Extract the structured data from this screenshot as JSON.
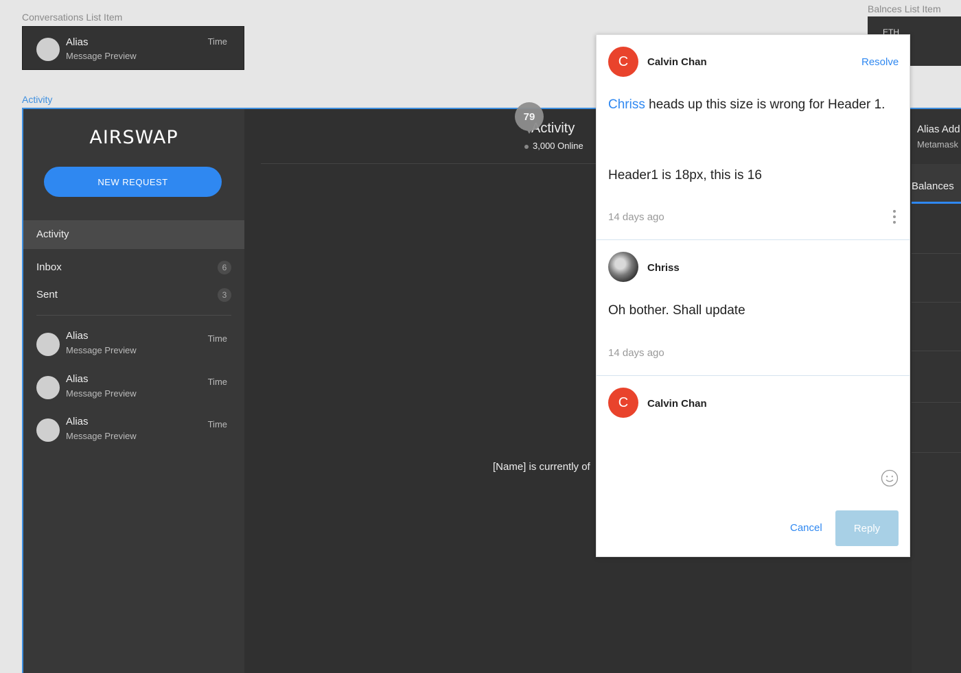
{
  "artboards": {
    "conversations_label": "Conversations List Item",
    "balances_label": "Balnces List Item",
    "activity_label": "Activity"
  },
  "conversation_item": {
    "alias": "Alias",
    "preview": "Message Preview",
    "time": "Time"
  },
  "balances_item": {
    "asset": "ETH"
  },
  "sidebar": {
    "logo": "AIRSWAP",
    "new_request": "NEW REQUEST",
    "nav": [
      {
        "label": "Activity",
        "active": true
      },
      {
        "label": "Inbox",
        "count": "6"
      },
      {
        "label": "Sent",
        "count": "3"
      }
    ],
    "list": [
      {
        "alias": "Alias",
        "preview": "Message Preview",
        "time": "Time"
      },
      {
        "alias": "Alias",
        "preview": "Message Preview",
        "time": "Time"
      },
      {
        "alias": "Alias",
        "preview": "Message Preview",
        "time": "Time"
      }
    ]
  },
  "main": {
    "title": "Activity",
    "online": "3,000 Online",
    "offline_message": "[Name] is currently of",
    "comment_pin": "79"
  },
  "right_panel": {
    "alias": "Alias Add",
    "meta": "Metamask",
    "tab": "Balances"
  },
  "comments": {
    "resolve": "Resolve",
    "thread": [
      {
        "initial": "C",
        "author": "Calvin Chan",
        "mention": "Chriss",
        "text": " heads up this size is wrong for Header 1.",
        "text2": "Header1 is 18px, this is 16",
        "time": "14 days ago"
      },
      {
        "author": "Chriss",
        "text": "Oh bother. Shall update",
        "time": "14 days ago"
      }
    ],
    "reply": {
      "initial": "C",
      "author": "Calvin Chan",
      "placeholder": "",
      "cancel": "Cancel",
      "submit": "Reply"
    }
  },
  "colors": {
    "accent": "#2f88f1",
    "avatar": "#e9432c",
    "reply_disabled": "#a8d0e6"
  }
}
